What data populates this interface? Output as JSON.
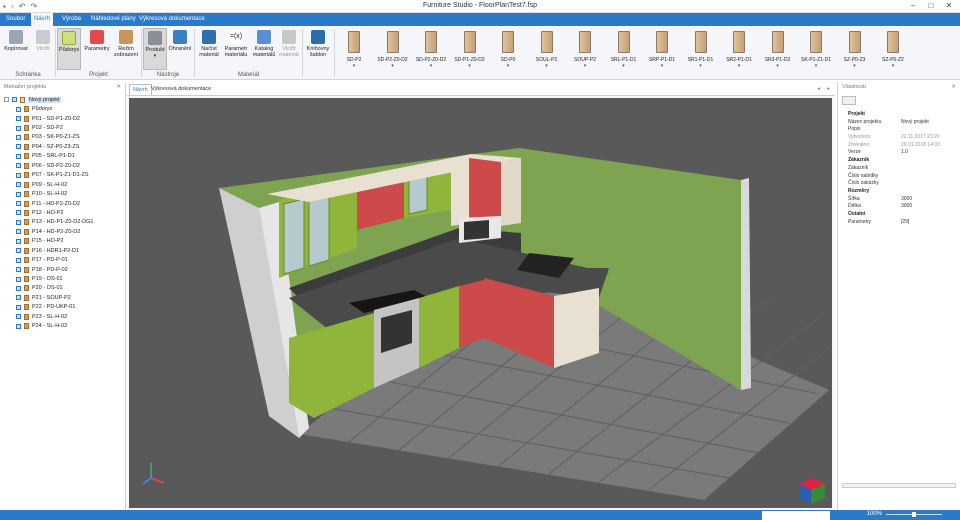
{
  "window": {
    "title": "Furniture Studio - FloorPlanTest7.fsp"
  },
  "menu_tabs": [
    "Soubor",
    "Návrh",
    "Výroba",
    "Náhledové plány",
    "Výkresová dokumentace"
  ],
  "active_tab": "Návrh",
  "ribbon": {
    "buttons": {
      "copy": "Kopírovat",
      "paste": "Vložit",
      "floorplan": "Půdorys",
      "params": "Parametry",
      "view_mode": "Režim zobrazení",
      "product": "Produkt",
      "edging": "Ohranění",
      "load_materials": "Načíst materiál",
      "material_params": "Parametr materiálu",
      "material_catalog": "Katalog materiálů",
      "insert_material": "Vložit materiál",
      "template_catalog": "Knihovny šablon"
    },
    "groups": {
      "clipboard": "Schránka",
      "project": "Projekt",
      "tools": "Nástroje",
      "material": "Materiál"
    },
    "cabinets": [
      "SD-P2",
      "SD-P2-Z0-D2",
      "SD-P2-Z0-D2",
      "SD-P1-Z0-D2",
      "SD-P0",
      "SOUL-P2",
      "SOUP-P2",
      "SRL-P1-D1",
      "SRP-P1-D1",
      "SR1-P1-D1",
      "SR2-P1-D1",
      "SR3-P1-D2",
      "SK-P1-Z1-D1",
      "SZ-P0-Z3",
      "SZ-P0-Z2"
    ]
  },
  "left_panel": {
    "title": "Manažer projektu",
    "root": "Nový projekt",
    "items": [
      "Půdorys",
      "P01 - SD-P1-Z0-D2",
      "P02 - SD-P2",
      "P03 - SK-P0-Z1-ZS",
      "P04 - SZ-P0-Z3-ZS",
      "P05 - SRL-P1-D1",
      "P06 - SD-P2-Z0-D2",
      "P07 - SK-P1-Z1-D1-ZS",
      "P09 - SL-H-02",
      "P10 - SL-H-02",
      "P11 - HD-P2-Z0-D2",
      "P12 - HO-P2",
      "P13 - HD-P1-Z0-D2-DG1",
      "P14 - HD-P2-Z0-D2",
      "P15 - HO-P2",
      "P16 - HDR1-P2-D1",
      "P17 - PD-P-01",
      "P18 - PD-P-02",
      "P19 - OS-01",
      "P20 - OS-01",
      "P21 - SOUP-P2",
      "P22 - PD-UKP-01",
      "P23 - SL-H-02",
      "P24 - SL-H-02"
    ]
  },
  "doc_tabs": [
    "Návrh",
    "Výkresová dokumentace"
  ],
  "right_panel": {
    "title": "Vlastnosti",
    "rows": [
      {
        "k": "Projekt",
        "v": "",
        "type": "sec"
      },
      {
        "k": "Název projektu",
        "v": "Nový projekt",
        "type": ""
      },
      {
        "k": "Popis",
        "v": "",
        "type": ""
      },
      {
        "k": "Vytvořeno",
        "v": "22.11.2017 23:20",
        "type": "gray"
      },
      {
        "k": "Změněno",
        "v": "26.01.2018 14:03",
        "type": "gray"
      },
      {
        "k": "Verze",
        "v": "1.0",
        "type": ""
      },
      {
        "k": "Zákazník",
        "v": "",
        "type": "sec"
      },
      {
        "k": "Zákazník",
        "v": "",
        "type": ""
      },
      {
        "k": "Číslo nabídky",
        "v": "",
        "type": ""
      },
      {
        "k": "Číslo zakázky",
        "v": "",
        "type": ""
      },
      {
        "k": "Rozměry",
        "v": "",
        "type": "sec"
      },
      {
        "k": "Šířka",
        "v": "3000",
        "type": ""
      },
      {
        "k": "Délka",
        "v": "3000",
        "type": ""
      },
      {
        "k": "Ostatní",
        "v": "",
        "type": "sec"
      },
      {
        "k": "Parametry",
        "v": "[29]",
        "type": ""
      }
    ]
  },
  "status": {
    "zoom": "100%"
  },
  "colors": {
    "accent": "#2b79c9",
    "wall": "#7aa84f",
    "cabinet_green": "#8fb53a",
    "cabinet_red": "#cc4a4a"
  }
}
